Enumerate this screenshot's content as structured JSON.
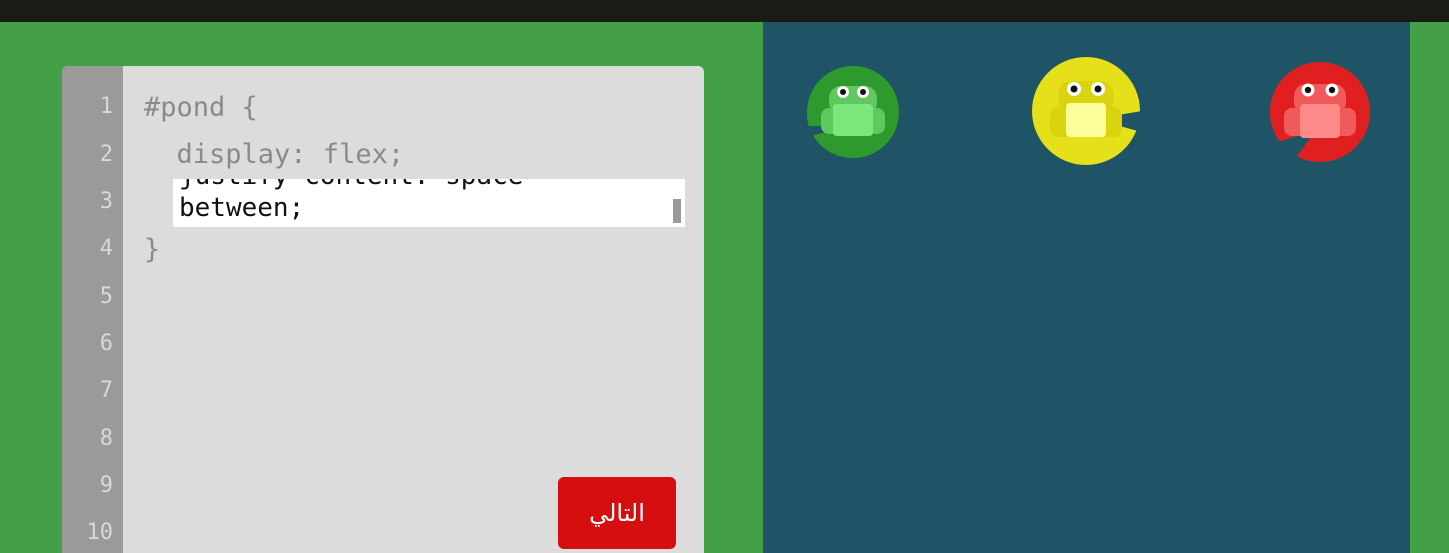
{
  "editor": {
    "line_numbers": [
      "1",
      "2",
      "3",
      "4",
      "5",
      "6",
      "7",
      "8",
      "9",
      "10"
    ],
    "lines": {
      "line1": "#pond {",
      "line2": "  display: flex;",
      "line4": "}"
    },
    "input": {
      "value": "between;"
    },
    "next_button_label": "التالي"
  },
  "pond": {
    "lilypads": [
      {
        "color": "green",
        "hex": "#2e9a2e",
        "frog_hex": "#7ce57c"
      },
      {
        "color": "yellow",
        "hex": "#e6e01a",
        "frog_hex": "#fdfd9a"
      },
      {
        "color": "red",
        "hex": "#e02020",
        "frog_hex": "#ff8a8a"
      }
    ]
  }
}
